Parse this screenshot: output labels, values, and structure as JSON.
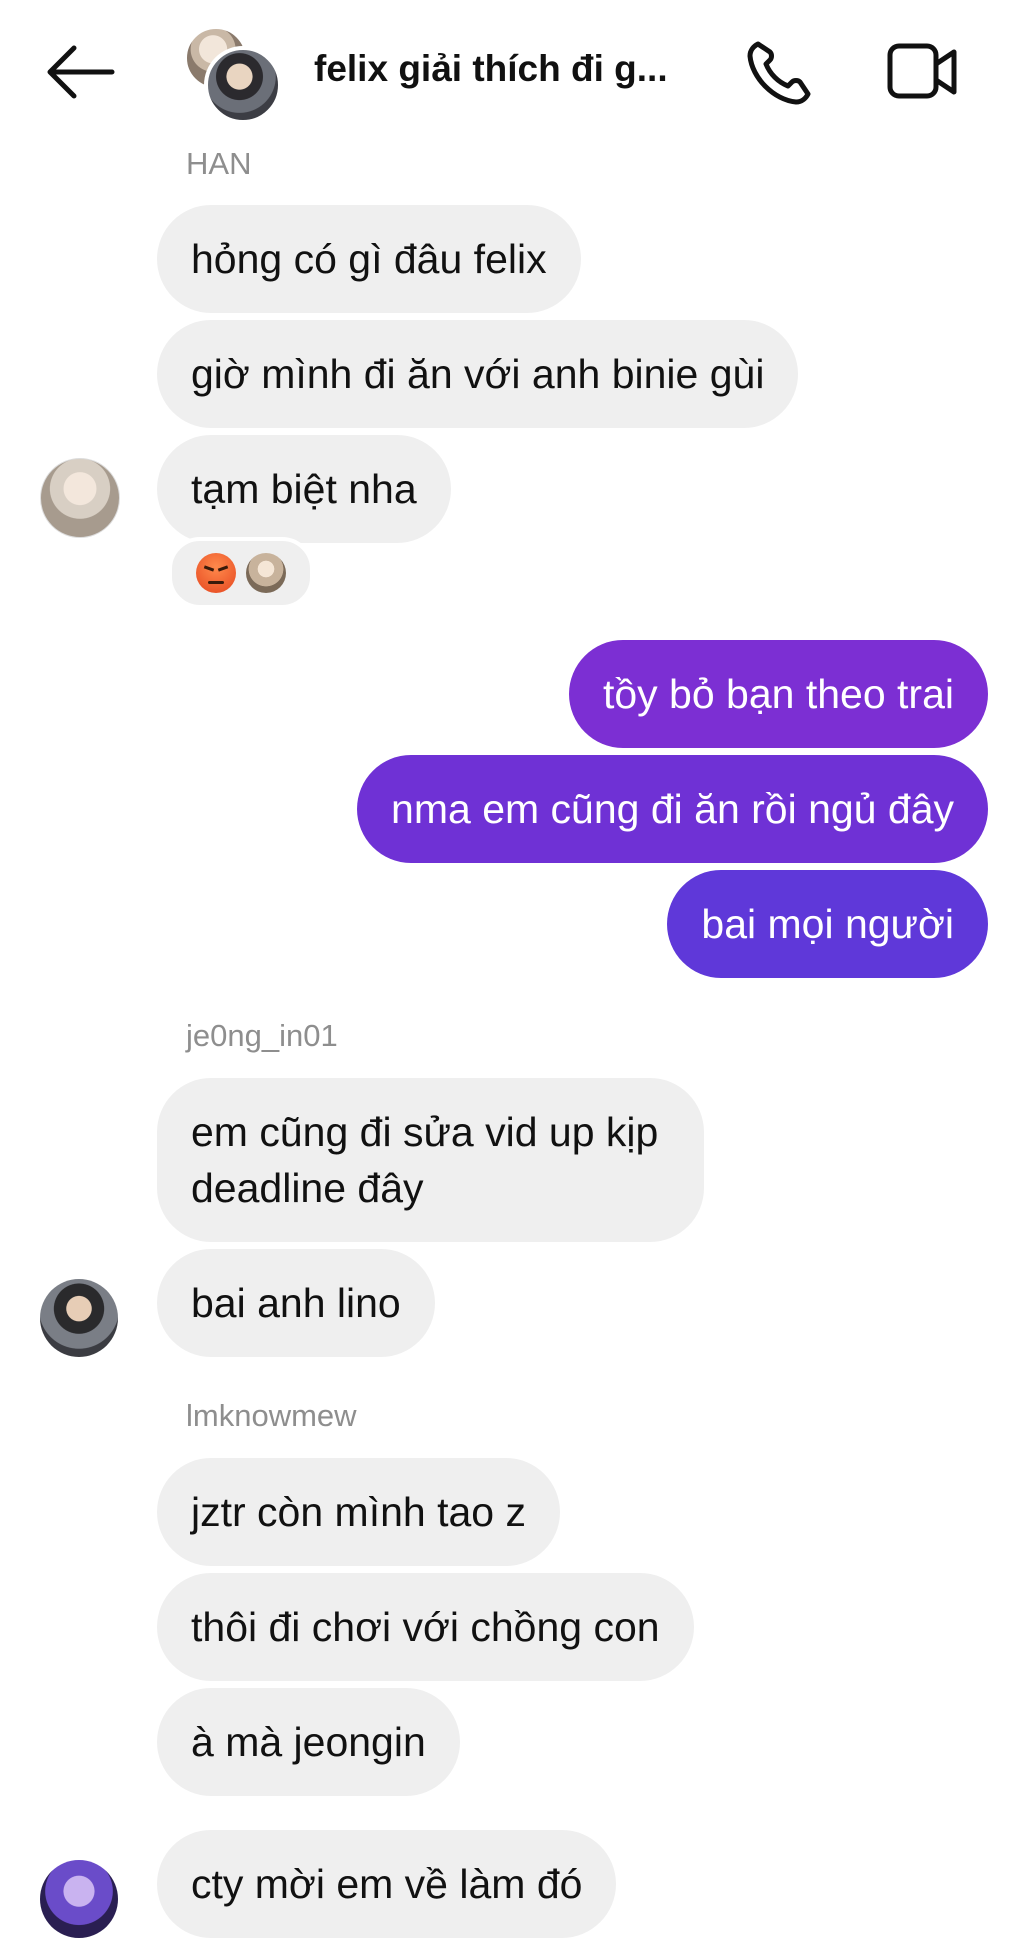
{
  "header": {
    "title": "felix giải thích đi g..."
  },
  "messages": {
    "han_name": "HAN",
    "han_1": "hỏng có gì đâu felix",
    "han_2": "giờ mình đi ăn với anh binie gùi",
    "han_3": "tạm biệt nha",
    "me_1": "tồy bỏ bạn theo trai",
    "me_2": "nma em cũng đi ăn rồi ngủ đây",
    "me_3": "bai mọi người",
    "jeong_name": "je0ng_in01",
    "jeong_1a": "em cũng đi sửa vid up kịp",
    "jeong_1b": "deadline đây",
    "jeong_2": "bai anh lino",
    "lm_name": "lmknowmew",
    "lm_1": "jztr còn mình tao z",
    "lm_2": "thôi đi chơi với chồng con",
    "lm_3": "à mà jeongin",
    "lm_4": "cty mời em về làm đó"
  },
  "colors": {
    "outgoing_top": "#7c2fd3",
    "outgoing_bottom": "#5f38d9",
    "incoming": "#efefef"
  },
  "icons": {
    "back": "arrow-left",
    "call": "phone",
    "video": "video-camera",
    "reaction": "angry-face"
  }
}
